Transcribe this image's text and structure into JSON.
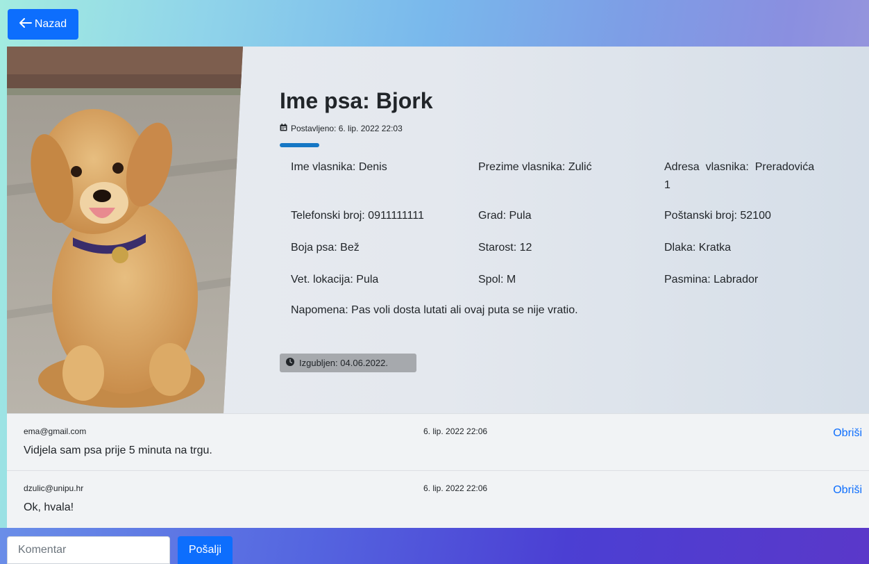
{
  "back_button": {
    "label": "Nazad",
    "icon": "arrow-left-icon"
  },
  "dog": {
    "title": "Ime psa: Bjork",
    "posted": "Postavljeno: 6. lip. 2022 22:03",
    "photo_alt": "Pas",
    "fields": {
      "owner_name": "Ime vlasnika: Denis",
      "owner_surname": "Prezime vlasnika: Zulić",
      "owner_address_line1": "Adresa  vlasnika:  Preradovića",
      "owner_address_line2": "1",
      "phone": "Telefonski broj: 0911111111",
      "city": "Grad: Pula",
      "postal": "Poštanski broj: 52100",
      "color": "Boja psa: Bež",
      "age": "Starost: 12",
      "fur": "Dlaka: Kratka",
      "vet_location": "Vet. lokacija: Pula",
      "sex": "Spol: M",
      "breed": "Pasmina: Labrador",
      "note": "Napomena: Pas voli dosta lutati ali ovaj puta se nije vratio."
    },
    "lost_badge": "Izgubljen: 04.06.2022."
  },
  "comments": [
    {
      "email": "ema@gmail.com",
      "time": "6. lip. 2022 22:06",
      "text": "Vidjela sam psa prije 5 minuta na trgu.",
      "delete_label": "Obriši"
    },
    {
      "email": "dzulic@unipu.hr",
      "time": "6. lip. 2022 22:06",
      "text": "Ok, hvala!",
      "delete_label": "Obriši"
    }
  ],
  "comment_form": {
    "placeholder": "Komentar",
    "value": "",
    "send_label": "Pošalji"
  },
  "colors": {
    "primary": "#0d6efd",
    "accent_bar": "#1577c5",
    "badge": "#a6a9ad"
  }
}
